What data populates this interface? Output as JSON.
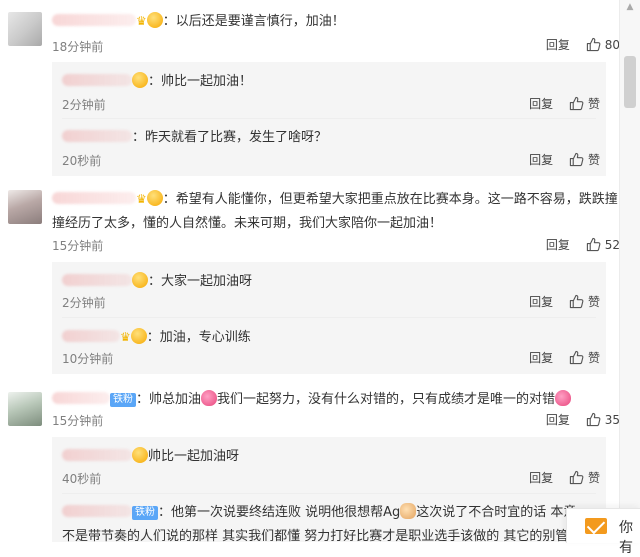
{
  "ui": {
    "reply_label": "回复"
  },
  "comments": [
    {
      "text": "：以后还是要谨言慎行，加油！",
      "time": "18分钟前",
      "likes": "80"
    },
    {
      "text": "：希望有人能懂你，但更希望大家把重点放在比赛本身。这一路不容易，跌跌撞",
      "text2": "撞经历了太多，懂的人自然懂。未来可期，我们大家陪你一起加油！",
      "time": "15分钟前",
      "likes": "52"
    },
    {
      "badge": "铁粉",
      "text_a": "：帅总加油",
      "text_b": "我们一起努力，没有什么对错的，只有成绩才是唯一的对错",
      "time": "15分钟前",
      "likes": "35"
    }
  ],
  "replies": [
    {
      "text": "：帅比一起加油！",
      "time": "2分钟前",
      "like_label": "赞"
    },
    {
      "text": "：昨天就看了比赛，发生了啥呀？",
      "time": "20秒前",
      "like_label": "赞"
    },
    {
      "text": "：大家一起加油呀",
      "time": "2分钟前",
      "like_label": "赞"
    },
    {
      "text": "：加油，专心训练",
      "time": "10分钟前",
      "like_label": "赞"
    },
    {
      "text": "帅比一起加油呀",
      "time": "40秒前",
      "like_label": "赞"
    },
    {
      "badge": "铁粉",
      "text_a": "：他第一次说要终结连败 说明他很想帮Ag",
      "text_b": "这次说了不合时宜的话 本意",
      "text2": "不是带节奏的人们说的那样 其实我们都懂 努力打好比赛才是职业选手该做的 其它的别管了"
    }
  ],
  "floatbar": {
    "text": "你有"
  }
}
